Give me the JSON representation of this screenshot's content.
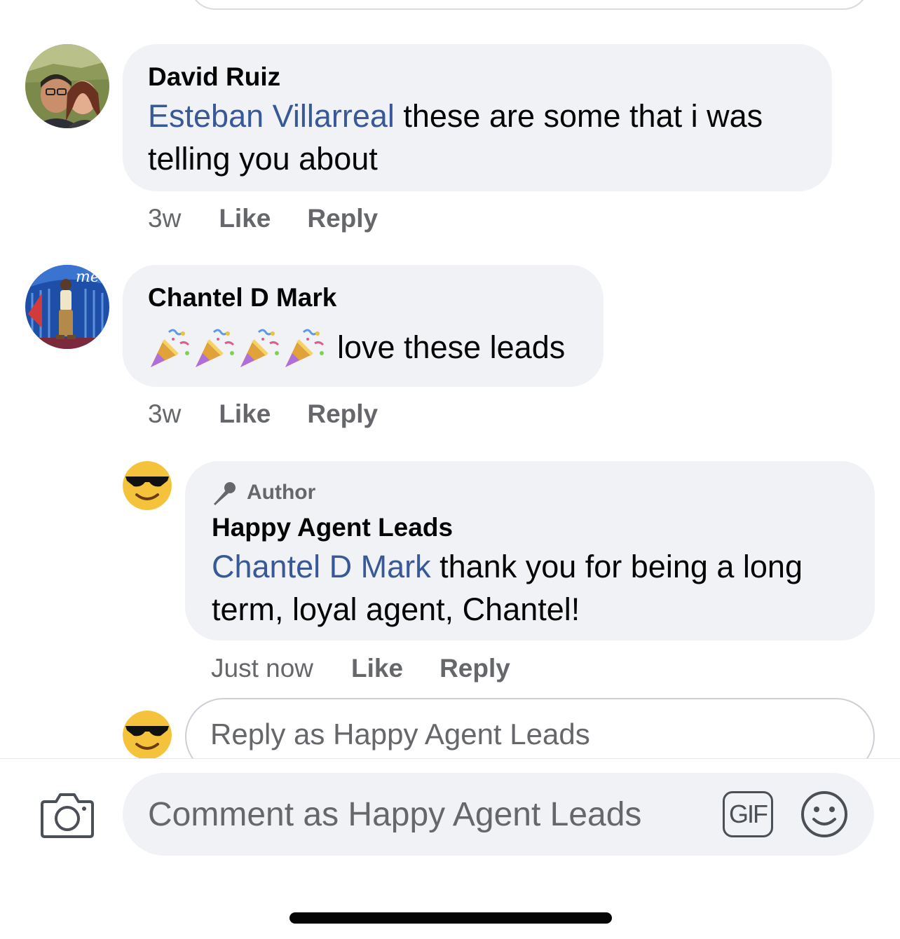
{
  "comments": [
    {
      "author": "David Ruiz",
      "mention": "Esteban Villarreal",
      "text_line1": " these are some that i was",
      "text_line2": "telling you about",
      "time": "3w",
      "like_label": "Like",
      "reply_label": "Reply"
    },
    {
      "author": "Chantel D Mark",
      "emoji_icons": [
        "party-popper-icon",
        "party-popper-icon",
        "party-popper-icon",
        "party-popper-icon"
      ],
      "text": "love these leads",
      "time": "3w",
      "like_label": "Like",
      "reply_label": "Reply"
    }
  ],
  "reply": {
    "badge": "Author",
    "badge_icon": "microphone-icon",
    "author": "Happy Agent Leads",
    "mention": "Chantel D Mark",
    "text_line1": " thank you for being a long",
    "text_line2": "term, loyal agent, Chantel!",
    "time": "Just now",
    "like_label": "Like",
    "reply_label": "Reply"
  },
  "reply_input": {
    "placeholder": "Reply as Happy Agent Leads"
  },
  "composer": {
    "placeholder": "Comment as Happy Agent Leads",
    "gif_label": "GIF",
    "camera_icon": "camera-icon",
    "emoji_icon": "smiley-icon"
  },
  "colors": {
    "mention": "#385898",
    "bubble": "#f0f2f5",
    "meta": "#65676b"
  }
}
